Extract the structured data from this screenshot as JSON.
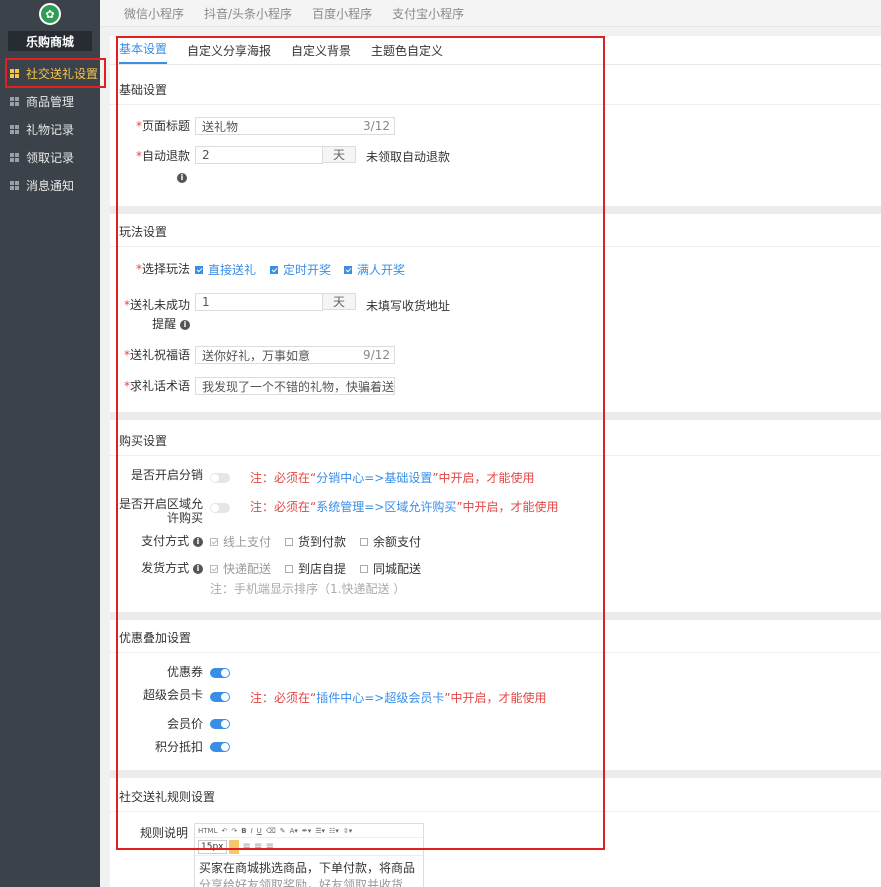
{
  "sidebar": {
    "store_name": "乐购商城",
    "items": [
      {
        "label": "社交送礼设置",
        "active": true
      },
      {
        "label": "商品管理"
      },
      {
        "label": "礼物记录"
      },
      {
        "label": "领取记录"
      },
      {
        "label": "消息通知"
      }
    ]
  },
  "top_tabs": [
    "微信小程序",
    "抖音/头条小程序",
    "百度小程序",
    "支付宝小程序"
  ],
  "sub_tabs": [
    "基本设置",
    "自定义分享海报",
    "自定义背景",
    "主题色自定义"
  ],
  "basic": {
    "title": "基础设置",
    "page_title_label": "页面标题",
    "page_title_value": "送礼物",
    "page_title_count": "3/12",
    "auto_refund_label": "自动退款",
    "auto_refund_value": "2",
    "auto_refund_unit": "天",
    "auto_refund_hint": "未领取自动退款"
  },
  "play": {
    "title": "玩法设置",
    "mode_label": "选择玩法",
    "modes": [
      "直接送礼",
      "定时开奖",
      "满人开奖"
    ],
    "remind_label_1": "送礼未成功",
    "remind_label_2": "提醒",
    "remind_value": "1",
    "remind_unit": "天",
    "remind_hint": "未填写收货地址",
    "blessing_label": "送礼祝福语",
    "blessing_value": "送你好礼，万事如意",
    "blessing_count": "9/12",
    "ask_label": "求礼话术语",
    "ask_value": "我发现了一个不错的礼物，快骗着送"
  },
  "buy": {
    "title": "购买设置",
    "dist_label": "是否开启分销",
    "dist_note_pre": "注：必须在“",
    "dist_note_link": "分销中心=>基础设置",
    "dist_note_post": "”中开启，才能使用",
    "region_label_1": "是否开启区域允",
    "region_label_2": "许购买",
    "region_note_pre": "注：必须在“",
    "region_note_link": "系统管理=>区域允许购买",
    "region_note_post": "”中开启，才能使用",
    "pay_label": "支付方式",
    "pay_options": [
      "线上支付",
      "货到付款",
      "余额支付"
    ],
    "ship_label": "发货方式",
    "ship_options": [
      "快递配送",
      "到店自提",
      "同城配送"
    ],
    "ship_note": "注：手机端显示排序（1.快递配送 ）"
  },
  "discount": {
    "title": "优惠叠加设置",
    "coupon_label": "优惠券",
    "vip_label": "超级会员卡",
    "vip_note_pre": "注：必须在“",
    "vip_note_link": "插件中心=>超级会员卡",
    "vip_note_post": "”中开启，才能使用",
    "member_price_label": "会员价",
    "points_label": "积分抵扣"
  },
  "rules": {
    "title": "社交送礼规则设置",
    "desc_label": "规则说明",
    "font_size": "15px",
    "content_line1": "买家在商城挑选商品，下单付款，将商品",
    "content_line2": "分享给好友领取奖励，好友领取并收货"
  }
}
